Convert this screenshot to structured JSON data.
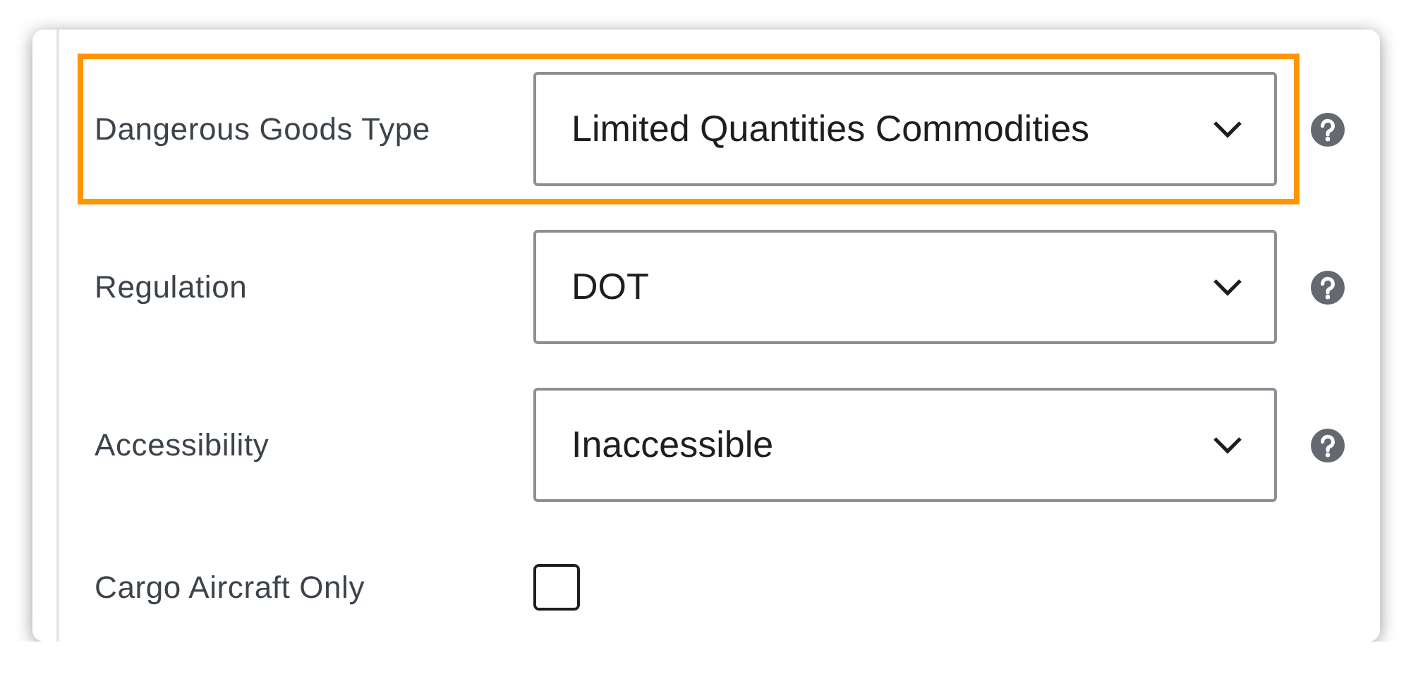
{
  "fields": [
    {
      "kind": "select",
      "label": "Dangerous Goods Type",
      "value": "Limited Quantities Commodities",
      "highlighted": true,
      "help": true
    },
    {
      "kind": "select",
      "label": "Regulation",
      "value": "DOT",
      "highlighted": false,
      "help": true
    },
    {
      "kind": "select",
      "label": "Accessibility",
      "value": "Inaccessible",
      "highlighted": false,
      "help": true
    },
    {
      "kind": "checkbox",
      "label": "Cargo Aircraft Only",
      "checked": false,
      "highlighted": false,
      "help": false
    }
  ]
}
